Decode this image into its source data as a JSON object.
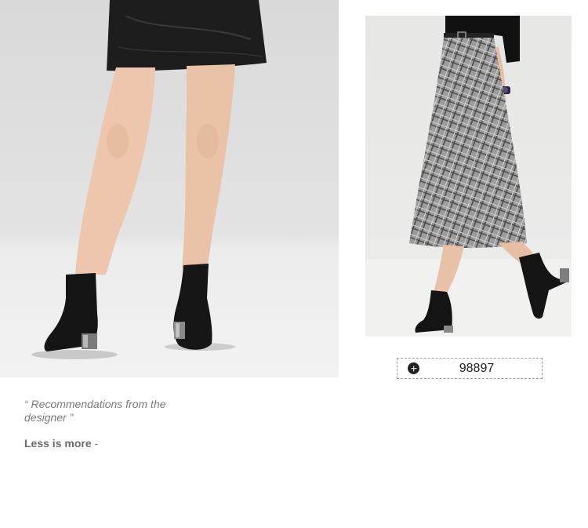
{
  "photos": {
    "left": {
      "alt": "model-in-leather-skirt-and-sock-boots"
    },
    "right": {
      "alt": "model-in-plaid-skirt-and-sock-boots"
    }
  },
  "sku": {
    "code": "98897",
    "icon": "plus-circle-icon"
  },
  "recommendation": {
    "quote": "“ Recommendations from the designer ”",
    "tagline_strong": "Less is more",
    "tagline_suffix": " -"
  }
}
